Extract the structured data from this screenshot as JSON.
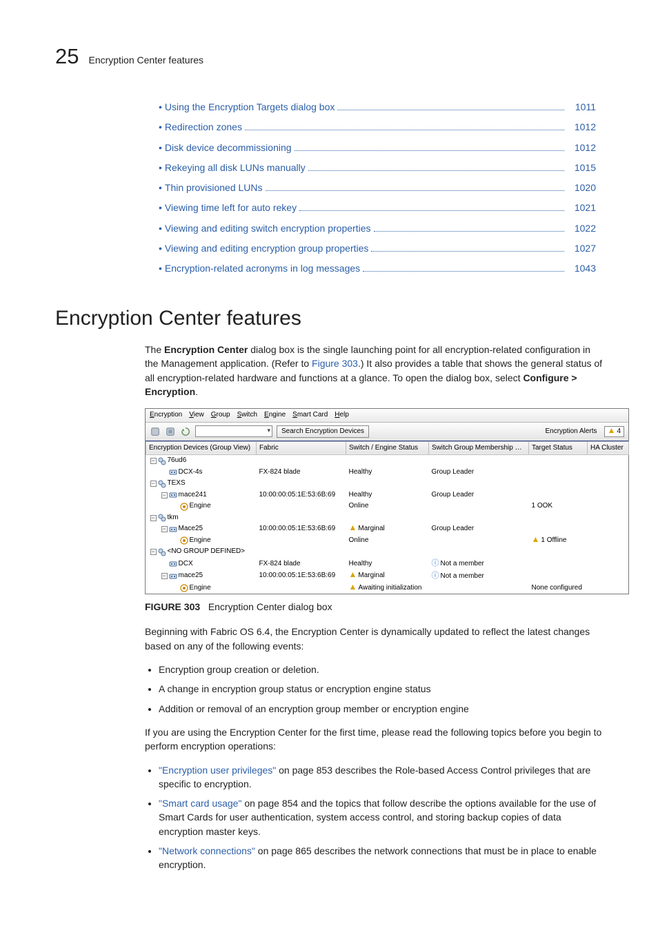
{
  "header": {
    "chapter_number": "25",
    "chapter_title": "Encryption Center features"
  },
  "toc": [
    {
      "title": "Using the Encryption Targets dialog box",
      "page": "1011"
    },
    {
      "title": "Redirection zones",
      "page": "1012"
    },
    {
      "title": "Disk device decommissioning",
      "page": "1012"
    },
    {
      "title": "Rekeying all disk LUNs manually",
      "page": "1015"
    },
    {
      "title": "Thin provisioned LUNs",
      "page": "1020"
    },
    {
      "title": "Viewing time left for auto rekey",
      "page": "1021"
    },
    {
      "title": "Viewing and editing switch encryption properties",
      "page": "1022"
    },
    {
      "title": "Viewing and editing encryption group properties",
      "page": "1027"
    },
    {
      "title": "Encryption-related acronyms in log messages",
      "page": "1043"
    }
  ],
  "section": {
    "heading": "Encryption Center features",
    "intro_pre": "The ",
    "intro_bold1": "Encryption Center",
    "intro_mid": " dialog box is the single launching point for all encryption-related configuration in the Management application. (Refer to ",
    "intro_link": "Figure 303",
    "intro_post": ".) It also provides a table that shows the general status of all encryption-related hardware and functions at a glance. To open the dialog box, select ",
    "intro_bold2": "Configure > Encryption",
    "intro_end": "."
  },
  "figure": {
    "label": "FIGURE 303",
    "caption": "Encryption Center dialog box"
  },
  "ec_window": {
    "menus": [
      "Encryption",
      "View",
      "Group",
      "Switch",
      "Engine",
      "Smart Card",
      "Help"
    ],
    "search_button": "Search Encryption Devices",
    "alerts_label": "Encryption Alerts",
    "alerts_count": "4",
    "columns": [
      "Encryption Devices (Group View)",
      "Fabric",
      "Switch / Engine Status",
      "Switch Group Membership Stat…",
      "Target Status",
      "HA Cluster"
    ],
    "rows": [
      {
        "indent": 0,
        "toggle": "−",
        "icon": "group",
        "name": "76ud6",
        "fabric": "",
        "status": "",
        "membership": "",
        "target": "",
        "ha": ""
      },
      {
        "indent": 1,
        "toggle": "",
        "icon": "switch",
        "name": "DCX-4s",
        "fabric": "FX-824 blade",
        "status": "Healthy",
        "membership": "Group Leader",
        "target": "",
        "ha": ""
      },
      {
        "indent": 0,
        "toggle": "−",
        "icon": "group",
        "name": "TEXS",
        "fabric": "",
        "status": "",
        "membership": "",
        "target": "",
        "ha": ""
      },
      {
        "indent": 1,
        "toggle": "−",
        "icon": "switch",
        "name": "mace241",
        "fabric": "10:00:00:05:1E:53:6B:69",
        "status": "Healthy",
        "membership": "Group Leader",
        "target": "",
        "ha": ""
      },
      {
        "indent": 2,
        "toggle": "",
        "icon": "engine",
        "name": "Engine",
        "fabric": "",
        "status": "Online",
        "membership": "",
        "target": "1 OOK",
        "ha": ""
      },
      {
        "indent": 0,
        "toggle": "−",
        "icon": "group",
        "name": "tkm",
        "fabric": "",
        "status": "",
        "membership": "",
        "target": "",
        "ha": ""
      },
      {
        "indent": 1,
        "toggle": "−",
        "icon": "switch",
        "name": "Mace25",
        "fabric": "10:00:00:05:1E:53:6B:69",
        "status_icon": "warn",
        "status": "Marginal",
        "membership": "Group Leader",
        "target": "",
        "ha": ""
      },
      {
        "indent": 2,
        "toggle": "",
        "icon": "engine",
        "name": "Engine",
        "fabric": "",
        "status": "Online",
        "membership": "",
        "target_icon": "warn",
        "target": "1 Offline",
        "ha": ""
      },
      {
        "indent": 0,
        "toggle": "−",
        "icon": "group",
        "name": "<NO GROUP DEFINED>",
        "fabric": "",
        "status": "",
        "membership": "",
        "target": "",
        "ha": ""
      },
      {
        "indent": 1,
        "toggle": "",
        "icon": "switch",
        "name": "DCX",
        "fabric": "FX-824 blade",
        "status": "Healthy",
        "membership_icon": "info",
        "membership": "Not a member",
        "target": "",
        "ha": ""
      },
      {
        "indent": 1,
        "toggle": "−",
        "icon": "switch",
        "name": "mace25",
        "fabric": "10:00:00:05:1E:53:6B:69",
        "status_icon": "warn",
        "status": "Marginal",
        "membership_icon": "info",
        "membership": "Not a member",
        "target": "",
        "ha": ""
      },
      {
        "indent": 2,
        "toggle": "",
        "icon": "engine",
        "name": "Engine",
        "fabric": "",
        "status_icon": "warn",
        "status": "Awaiting initialization",
        "membership": "",
        "target": "None configured",
        "ha": ""
      }
    ]
  },
  "post_figure": {
    "p1": "Beginning with Fabric OS 6.4, the Encryption Center is dynamically updated to reflect the latest changes based on any of the following events:",
    "events": [
      "Encryption group creation or deletion.",
      "A change in encryption group status or encryption engine status",
      "Addition or removal of an encryption group member or encryption engine"
    ],
    "p2": "If you are using the Encryption Center for the first time, please read the following topics before you begin to perform encryption operations:",
    "topics": [
      {
        "link": "\"Encryption user privileges\"",
        "rest": " on page 853 describes the Role-based Access Control privileges that are specific to encryption."
      },
      {
        "link": "\"Smart card usage\"",
        "rest": " on page 854 and the topics that follow describe the options available for the use of Smart Cards for user authentication, system access control, and storing backup copies of data encryption master keys."
      },
      {
        "link": "\"Network connections\"",
        "rest": " on page 865 describes the network connections that must be in place to enable encryption."
      }
    ]
  }
}
